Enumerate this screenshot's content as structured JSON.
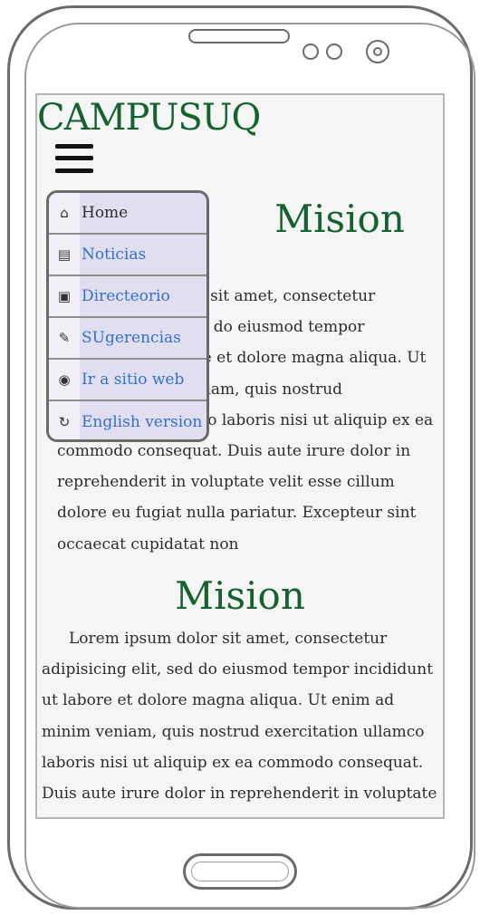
{
  "app": {
    "brand": "CAMPUSUQ"
  },
  "sections": [
    {
      "heading": "Mision",
      "body": "Lorem ipsum dolor sit amet, consectetur adipisicing elit, sed do eiusmod tempor incididunt ut labore et dolore magna aliqua. Ut enim ad minim veniam, quis nostrud exercitation ullamco laboris nisi ut aliquip ex ea commodo consequat. Duis aute irure dolor in reprehenderit in voluptate velit esse cillum dolore eu fugiat nulla pariatur. Excepteur sint occaecat cupidatat non"
    },
    {
      "heading": "Mision",
      "body": "Lorem ipsum dolor sit amet, consectetur adipisicing elit, sed do eiusmod tempor incididunt ut labore et dolore magna aliqua. Ut enim ad minim veniam, quis nostrud exercitation ullamco laboris nisi ut aliquip ex ea commodo consequat. Duis aute irure dolor in reprehenderit in voluptate velit"
    }
  ],
  "menu": {
    "items": [
      {
        "label": "Home",
        "icon": "home-icon"
      },
      {
        "label": "Noticias",
        "icon": "newspaper-icon"
      },
      {
        "label": "Directeorio",
        "icon": "contact-book-icon"
      },
      {
        "label": "SUgerencias",
        "icon": "pencil-icon"
      },
      {
        "label": "Ir a sitio web",
        "icon": "globe-icon"
      },
      {
        "label": "English version",
        "icon": "refresh-icon"
      }
    ]
  },
  "colors": {
    "brand": "#13632e",
    "link": "#2f6fd6",
    "menu_bg": "#e1def0"
  }
}
